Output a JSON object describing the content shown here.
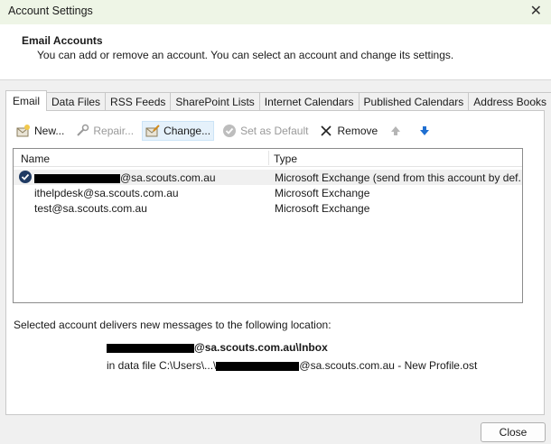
{
  "window": {
    "title": "Account Settings",
    "close_glyph": "✕"
  },
  "header": {
    "title": "Email Accounts",
    "description": "You can add or remove an account. You can select an account and change its settings."
  },
  "tabs": [
    {
      "label": "Email",
      "active": true
    },
    {
      "label": "Data Files"
    },
    {
      "label": "RSS Feeds"
    },
    {
      "label": "SharePoint Lists"
    },
    {
      "label": "Internet Calendars"
    },
    {
      "label": "Published Calendars"
    },
    {
      "label": "Address Books"
    }
  ],
  "toolbar": {
    "new_label": "New...",
    "repair_label": "Repair...",
    "change_label": "Change...",
    "default_label": "Set as Default",
    "remove_label": "Remove"
  },
  "list": {
    "col_name": "Name",
    "col_type": "Microsoft Exchange",
    "col_type_header": "Type",
    "rows": [
      {
        "name": "@sa.scouts.com.au",
        "type": "Microsoft Exchange (send from this account by def..."
      },
      {
        "name": "ithelpdesk@sa.scouts.com.au",
        "type": "Microsoft Exchange"
      },
      {
        "name": "test@sa.scouts.com.au",
        "type": "Microsoft Exchange"
      }
    ]
  },
  "delivery": {
    "caption": "Selected account delivers new messages to the following location:",
    "inbox_suffix": "@sa.scouts.com.au\\Inbox",
    "datafile_prefix": "in data file C:\\Users\\...\\",
    "datafile_suffix": "@sa.scouts.com.au - New Profile.ost"
  },
  "footer": {
    "close_label": "Close"
  },
  "colors": {
    "accent": "#1f6fd1",
    "titlebar_bg": "#eef5e6",
    "selected_row": "#f0f0f0"
  }
}
